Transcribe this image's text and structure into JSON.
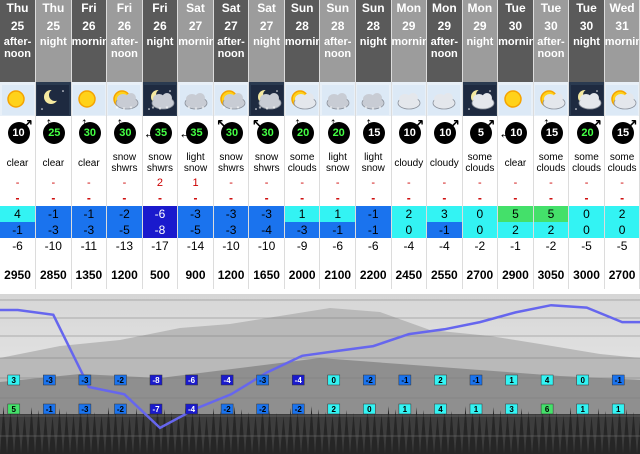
{
  "columns": [
    {
      "day": "Thu",
      "date": "25",
      "period": [
        "after-",
        "noon"
      ],
      "tone": "dark",
      "icon": "sun-icon",
      "wind": "10",
      "wind_dir": "ne",
      "wind_ring": "white",
      "summary": [
        "clear"
      ],
      "snow": "-",
      "rain": "-",
      "max": "4",
      "max_cls": "tmp-cyan",
      "min": "-1",
      "min_cls": "tmp-lblue",
      "chill": "-6",
      "freeze": "2950"
    },
    {
      "day": "Thu",
      "date": "25",
      "period": [
        "night"
      ],
      "tone": "light",
      "icon": "moon-clear-icon",
      "wind": "25",
      "wind_dir": "n",
      "wind_ring": "green",
      "summary": [
        "clear"
      ],
      "snow": "-",
      "rain": "-",
      "max": "-1",
      "max_cls": "tmp-blue",
      "min": "-3",
      "min_cls": "tmp-blue",
      "chill": "-10",
      "freeze": "2850"
    },
    {
      "day": "Fri",
      "date": "26",
      "period": [
        "morning"
      ],
      "tone": "dark",
      "icon": "sun-icon",
      "wind": "30",
      "wind_dir": "n",
      "wind_ring": "green",
      "summary": [
        "clear"
      ],
      "snow": "-",
      "rain": "-",
      "max": "-1",
      "max_cls": "tmp-blue",
      "min": "-3",
      "min_cls": "tmp-blue",
      "chill": "-11",
      "freeze": "1350"
    },
    {
      "day": "Fri",
      "date": "26",
      "period": [
        "after-",
        "noon"
      ],
      "tone": "light",
      "icon": "sun-cloud-snow-icon",
      "wind": "30",
      "wind_dir": "n",
      "wind_ring": "green",
      "summary": [
        "snow",
        "shwrs"
      ],
      "snow": "-",
      "rain": "-",
      "max": "-2",
      "max_cls": "tmp-blue",
      "min": "-5",
      "min_cls": "tmp-blue",
      "chill": "-13",
      "freeze": "1200"
    },
    {
      "day": "Fri",
      "date": "26",
      "period": [
        "night"
      ],
      "tone": "dark",
      "icon": "moon-cloud-snow-icon",
      "wind": "35",
      "wind_dir": "w",
      "wind_ring": "green",
      "summary": [
        "snow",
        "shwrs"
      ],
      "snow": "2",
      "rain": "-",
      "max": "-6",
      "max_cls": "tmp-dark",
      "min": "-8",
      "min_cls": "tmp-dark",
      "chill": "-17",
      "freeze": "500"
    },
    {
      "day": "Sat",
      "date": "27",
      "period": [
        "morning"
      ],
      "tone": "light",
      "icon": "cloud-snow-icon",
      "wind": "35",
      "wind_dir": "w",
      "wind_ring": "green",
      "summary": [
        "light",
        "snow"
      ],
      "snow": "1",
      "rain": "-",
      "max": "-3",
      "max_cls": "tmp-blue",
      "min": "-5",
      "min_cls": "tmp-blue",
      "chill": "-14",
      "freeze": "900"
    },
    {
      "day": "Sat",
      "date": "27",
      "period": [
        "after-",
        "noon"
      ],
      "tone": "dark",
      "icon": "sun-cloud-snow-icon",
      "wind": "30",
      "wind_dir": "nw",
      "wind_ring": "green",
      "summary": [
        "snow",
        "shwrs"
      ],
      "snow": "-",
      "rain": "-",
      "max": "-3",
      "max_cls": "tmp-blue",
      "min": "-3",
      "min_cls": "tmp-blue",
      "chill": "-10",
      "freeze": "1200"
    },
    {
      "day": "Sat",
      "date": "27",
      "period": [
        "night"
      ],
      "tone": "light",
      "icon": "moon-cloud-snow-icon",
      "wind": "30",
      "wind_dir": "nw",
      "wind_ring": "green",
      "summary": [
        "snow",
        "shwrs"
      ],
      "snow": "-",
      "rain": "-",
      "max": "-3",
      "max_cls": "tmp-blue",
      "min": "-4",
      "min_cls": "tmp-blue",
      "chill": "-10",
      "freeze": "1650"
    },
    {
      "day": "Sun",
      "date": "28",
      "period": [
        "morning"
      ],
      "tone": "dark",
      "icon": "sun-cloud-icon",
      "wind": "20",
      "wind_dir": "n",
      "wind_ring": "green",
      "summary": [
        "some",
        "clouds"
      ],
      "snow": "-",
      "rain": "-",
      "max": "1",
      "max_cls": "tmp-cyan",
      "min": "-3",
      "min_cls": "tmp-blue",
      "chill": "-9",
      "freeze": "2000"
    },
    {
      "day": "Sun",
      "date": "28",
      "period": [
        "after-",
        "noon"
      ],
      "tone": "light",
      "icon": "cloud-snow-icon",
      "wind": "20",
      "wind_dir": "n",
      "wind_ring": "green",
      "summary": [
        "light",
        "snow"
      ],
      "snow": "-",
      "rain": "-",
      "max": "1",
      "max_cls": "tmp-cyan",
      "min": "-1",
      "min_cls": "tmp-blue",
      "chill": "-6",
      "freeze": "2100"
    },
    {
      "day": "Sun",
      "date": "28",
      "period": [
        "night"
      ],
      "tone": "dark",
      "icon": "cloud-snow-icon",
      "wind": "15",
      "wind_dir": "n",
      "wind_ring": "white",
      "summary": [
        "light",
        "snow"
      ],
      "snow": "-",
      "rain": "-",
      "max": "-1",
      "max_cls": "tmp-blue",
      "min": "-1",
      "min_cls": "tmp-blue",
      "chill": "-6",
      "freeze": "2200"
    },
    {
      "day": "Mon",
      "date": "29",
      "period": [
        "morning"
      ],
      "tone": "light",
      "icon": "cloud-icon",
      "wind": "10",
      "wind_dir": "ne",
      "wind_ring": "white",
      "summary": [
        "cloudy"
      ],
      "snow": "-",
      "rain": "-",
      "max": "2",
      "max_cls": "tmp-cyan",
      "min": "0",
      "min_cls": "tmp-cyan",
      "chill": "-4",
      "freeze": "2450"
    },
    {
      "day": "Mon",
      "date": "29",
      "period": [
        "after-",
        "noon"
      ],
      "tone": "dark",
      "icon": "cloud-icon",
      "wind": "10",
      "wind_dir": "ne",
      "wind_ring": "white",
      "summary": [
        "cloudy"
      ],
      "snow": "-",
      "rain": "-",
      "max": "3",
      "max_cls": "tmp-cyan",
      "min": "-1",
      "min_cls": "tmp-blue",
      "chill": "-4",
      "freeze": "2550"
    },
    {
      "day": "Mon",
      "date": "29",
      "period": [
        "night"
      ],
      "tone": "light",
      "icon": "moon-cloud-icon",
      "wind": "5",
      "wind_dir": "ne",
      "wind_ring": "white",
      "summary": [
        "some",
        "clouds"
      ],
      "snow": "-",
      "rain": "-",
      "max": "0",
      "max_cls": "tmp-cyan",
      "min": "0",
      "min_cls": "tmp-cyan",
      "chill": "-2",
      "freeze": "2700"
    },
    {
      "day": "Tue",
      "date": "30",
      "period": [
        "morning"
      ],
      "tone": "dark",
      "icon": "sun-icon",
      "wind": "10",
      "wind_dir": "w",
      "wind_ring": "white",
      "summary": [
        "clear"
      ],
      "snow": "-",
      "rain": "-",
      "max": "5",
      "max_cls": "tmp-green",
      "min": "2",
      "min_cls": "tmp-cyan",
      "chill": "-1",
      "freeze": "2900"
    },
    {
      "day": "Tue",
      "date": "30",
      "period": [
        "after-",
        "noon"
      ],
      "tone": "light",
      "icon": "sun-cloud-icon",
      "wind": "15",
      "wind_dir": "n",
      "wind_ring": "white",
      "summary": [
        "some",
        "clouds"
      ],
      "snow": "-",
      "rain": "-",
      "max": "5",
      "max_cls": "tmp-green",
      "min": "2",
      "min_cls": "tmp-cyan",
      "chill": "-2",
      "freeze": "3050"
    },
    {
      "day": "Tue",
      "date": "30",
      "period": [
        "night"
      ],
      "tone": "dark",
      "icon": "moon-cloud-icon",
      "wind": "20",
      "wind_dir": "ne",
      "wind_ring": "green",
      "summary": [
        "some",
        "clouds"
      ],
      "snow": "-",
      "rain": "-",
      "max": "0",
      "max_cls": "tmp-cyan",
      "min": "0",
      "min_cls": "tmp-cyan",
      "chill": "-5",
      "freeze": "3000"
    },
    {
      "day": "Wed",
      "date": "31",
      "period": [
        "morning"
      ],
      "tone": "light",
      "icon": "sun-cloud-icon",
      "wind": "15",
      "wind_dir": "ne",
      "wind_ring": "white",
      "summary": [
        "some",
        "clouds"
      ],
      "snow": "-",
      "rain": "-",
      "max": "2",
      "max_cls": "tmp-cyan",
      "min": "0",
      "min_cls": "tmp-cyan",
      "chill": "-5",
      "freeze": "2700"
    }
  ],
  "chart_data": {
    "type": "line",
    "series": [
      {
        "values": [
          3,
          -3,
          -3,
          -2,
          -8,
          -6,
          -4,
          -3,
          -4,
          0,
          -2,
          -1,
          2,
          -1,
          1,
          4,
          0,
          -1
        ]
      },
      {
        "values": [
          5,
          -1,
          -3,
          -2,
          -7,
          -4,
          -2,
          -2,
          -2,
          2,
          0,
          1,
          4,
          1,
          3,
          6,
          1,
          1
        ]
      }
    ],
    "freezing_level": [
      2950,
      2850,
      1350,
      1200,
      500,
      900,
      1200,
      1650,
      2000,
      2100,
      2200,
      2450,
      2550,
      2700,
      2900,
      3050,
      3000,
      2700
    ],
    "freezing_range": [
      0,
      3200
    ]
  }
}
